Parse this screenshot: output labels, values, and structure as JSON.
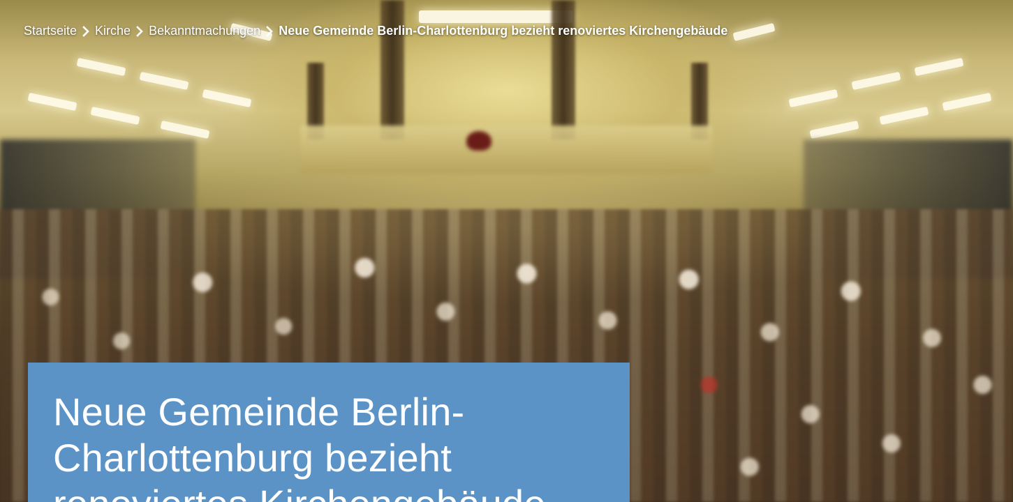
{
  "breadcrumb": {
    "items": [
      {
        "label": "Startseite"
      },
      {
        "label": "Kirche"
      },
      {
        "label": "Bekanntmachungen"
      }
    ],
    "current": "Neue Gemeinde Berlin-Charlottenburg bezieht renoviertes Kirchengebäude"
  },
  "hero": {
    "title": "Neue Gemeinde Berlin-Charlottenburg bezieht renoviertes Kirchengebäude",
    "title_box_color": "#5b93c7"
  },
  "icons": {
    "separator": "chevron-right-icon"
  }
}
